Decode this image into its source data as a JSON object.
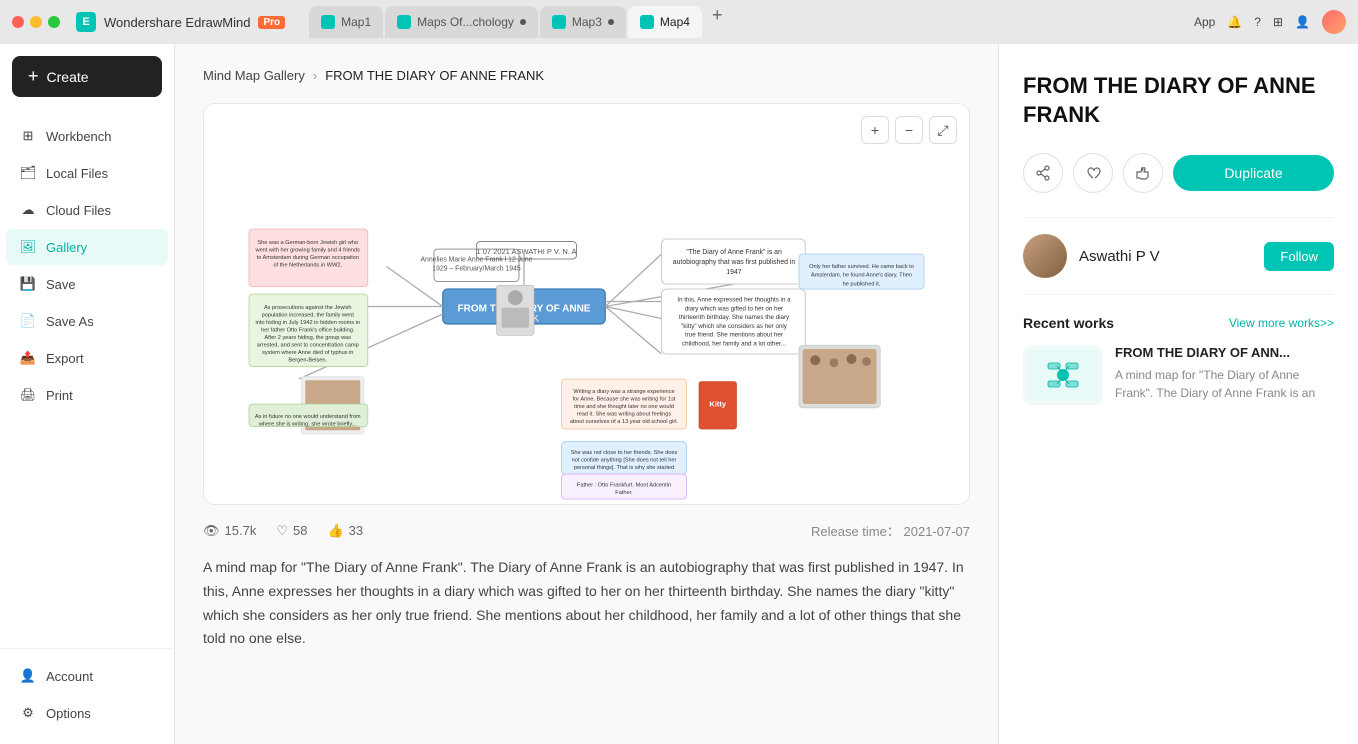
{
  "titlebar": {
    "app_name": "Wondershare EdrawMind",
    "pro_label": "Pro",
    "tabs": [
      {
        "id": "tab1",
        "label": "Map1",
        "active": false,
        "has_dot": false
      },
      {
        "id": "tab2",
        "label": "Maps Of...chology",
        "active": false,
        "has_dot": true
      },
      {
        "id": "tab3",
        "label": "Map3",
        "active": false,
        "has_dot": true
      },
      {
        "id": "tab4",
        "label": "Map4",
        "active": true,
        "has_dot": false
      }
    ],
    "app_btn": "App",
    "bell_icon": "🔔"
  },
  "sidebar": {
    "create_label": "Create",
    "nav_items": [
      {
        "id": "workbench",
        "label": "Workbench",
        "icon": "⊞",
        "active": false
      },
      {
        "id": "local-files",
        "label": "Local Files",
        "icon": "🗂",
        "active": false
      },
      {
        "id": "cloud-files",
        "label": "Cloud Files",
        "icon": "☁",
        "active": false
      },
      {
        "id": "gallery",
        "label": "Gallery",
        "icon": "🖼",
        "active": true
      },
      {
        "id": "save",
        "label": "Save",
        "icon": "💾",
        "active": false
      },
      {
        "id": "save-as",
        "label": "Save As",
        "icon": "📄",
        "active": false
      },
      {
        "id": "export",
        "label": "Export",
        "icon": "📤",
        "active": false
      },
      {
        "id": "print",
        "label": "Print",
        "icon": "🖨",
        "active": false
      }
    ],
    "bottom_items": [
      {
        "id": "account",
        "label": "Account",
        "icon": "👤"
      },
      {
        "id": "options",
        "label": "Options",
        "icon": "⚙"
      }
    ]
  },
  "breadcrumb": {
    "gallery_label": "Mind Map Gallery",
    "separator": "›",
    "current": "FROM THE DIARY OF ANNE FRANK"
  },
  "map": {
    "title": "FROM THE DIARY OF ANNE FRANK",
    "zoom_in": "+",
    "zoom_out": "−",
    "fullscreen": "⤢"
  },
  "stats": {
    "views": "15.7k",
    "likes": "58",
    "thumbs": "33",
    "release_label": "Release time：",
    "release_date": "2021-07-07"
  },
  "description": "A mind map for \"The Diary of Anne Frank\". The Diary of Anne Frank is an autobiography that was first published in 1947. In this, Anne expresses her thoughts in a diary which was gifted to her on her thirteenth birthday. She names the diary \"kitty\" which she considers as her only true friend. She mentions about her childhood, her family and a lot of other things that she told no one else.",
  "right_panel": {
    "title": "FROM THE DIARY OF ANNE FRANK",
    "share_icon": "share",
    "heart_icon": "heart",
    "thumb_icon": "thumb",
    "duplicate_label": "Duplicate",
    "author_name": "Aswathi P V",
    "follow_label": "Follow",
    "recent_works_title": "Recent works",
    "view_more_label": "View more works>>",
    "recent_work": {
      "title": "FROM THE DIARY OF ANN...",
      "description": "A mind map for \"The Diary of Anne Frank\". The Diary of Anne Frank is an"
    }
  }
}
